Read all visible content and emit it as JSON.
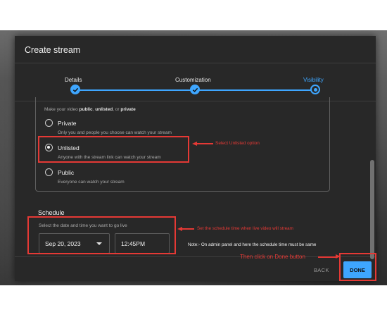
{
  "dialog": {
    "title": "Create stream"
  },
  "steps": [
    {
      "label": "Details",
      "state": "done"
    },
    {
      "label": "Customization",
      "state": "done"
    },
    {
      "label": "Visibility",
      "state": "current"
    }
  ],
  "visibility": {
    "intro_prefix": "Make your video ",
    "intro_public": "public",
    "intro_sep1": ", ",
    "intro_unlisted": "unlisted",
    "intro_sep2": ", or ",
    "intro_private": "private",
    "options": [
      {
        "title": "Private",
        "description": "Only you and people you choose can watch your stream",
        "selected": false
      },
      {
        "title": "Unlisted",
        "description": "Anyone with the stream link can watch your stream",
        "selected": true
      },
      {
        "title": "Public",
        "description": "Everyone can watch your stream",
        "selected": false
      }
    ]
  },
  "schedule": {
    "title": "Schedule",
    "description": "Select the date and time you want to go live",
    "date_value": "Sep 20, 2023",
    "time_value": "12:45PM"
  },
  "footer": {
    "back_label": "BACK",
    "done_label": "DONE"
  },
  "annotations": {
    "unlisted_hint": "Select Unlisted option",
    "schedule_hint": "Set the schedule time when live video will stream",
    "note": "Note:- On admin panel and here the schedule time must be same",
    "done_hint": "Then click on Done button"
  },
  "colors": {
    "accent": "#3ea6ff",
    "dialog_bg": "#282828",
    "annotation": "#e53935"
  }
}
